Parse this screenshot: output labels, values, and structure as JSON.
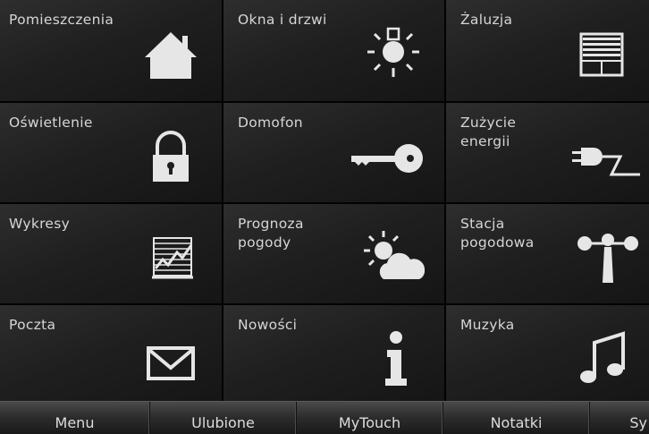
{
  "tiles": [
    {
      "label": "Pomieszczenia",
      "icon": "house-icon"
    },
    {
      "label": "Okna i drzwi",
      "icon": "light-bulb-icon"
    },
    {
      "label": "Żaluzja",
      "icon": "blinds-icon"
    },
    {
      "label": "Oświetlenie",
      "icon": "padlock-icon"
    },
    {
      "label": "Domofon",
      "icon": "key-icon"
    },
    {
      "label": "Zużycie\nenergii",
      "icon": "power-plug-icon"
    },
    {
      "label": "Wykresy",
      "icon": "chart-icon"
    },
    {
      "label": "Prognoza\npogody",
      "icon": "sun-cloud-icon"
    },
    {
      "label": "Stacja\npogodowa",
      "icon": "anemometer-icon"
    },
    {
      "label": "Poczta",
      "icon": "envelope-icon"
    },
    {
      "label": "Nowości",
      "icon": "info-icon"
    },
    {
      "label": "Muzyka",
      "icon": "music-note-icon"
    }
  ],
  "bottom_bar": {
    "tabs": [
      "Menu",
      "Ulubione",
      "MyTouch",
      "Notatki",
      "Sy"
    ]
  },
  "colors": {
    "tile_text": "#d6d6d6",
    "icon": "#e6e6e6",
    "background": "#0a0a0a"
  }
}
